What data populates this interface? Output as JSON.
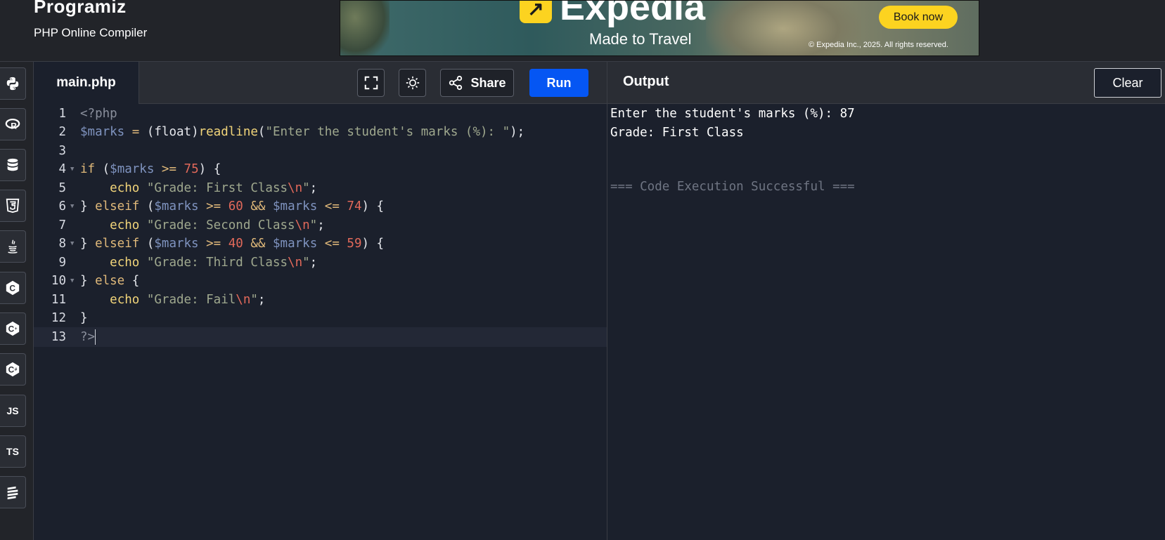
{
  "header": {
    "brand": "Programiz",
    "subtitle": "PHP Online Compiler"
  },
  "ad": {
    "brand": "Expedia",
    "tagline": "Made to Travel",
    "cta": "Book now",
    "copyright": "© Expedia Inc., 2025. All rights reserved.",
    "accent": "#fcd320"
  },
  "rail": {
    "items": [
      {
        "name": "python",
        "label": ""
      },
      {
        "name": "r",
        "label": "R"
      },
      {
        "name": "sql",
        "label": ""
      },
      {
        "name": "html",
        "label": "5"
      },
      {
        "name": "java",
        "label": ""
      },
      {
        "name": "c",
        "label": "C"
      },
      {
        "name": "cpp",
        "label": "C"
      },
      {
        "name": "csharp",
        "label": "C"
      },
      {
        "name": "javascript",
        "label": "JS"
      },
      {
        "name": "typescript",
        "label": "TS"
      },
      {
        "name": "swift",
        "label": ""
      }
    ]
  },
  "editor": {
    "file_tab": "main.php",
    "share_label": "Share",
    "run_label": "Run",
    "run_color": "#0556f3",
    "line_numbers": [
      "1",
      "2",
      "3",
      "4",
      "5",
      "6",
      "7",
      "8",
      "9",
      "10",
      "11",
      "12",
      "13"
    ],
    "lines": [
      "<?php",
      "$marks = (float)readline(\"Enter the student's marks (%): \");",
      "",
      "if ($marks >= 75) {",
      "    echo \"Grade: First Class\\n\";",
      "} elseif ($marks >= 60 && $marks <= 74) {",
      "    echo \"Grade: Second Class\\n\";",
      "} elseif ($marks >= 40 && $marks <= 59) {",
      "    echo \"Grade: Third Class\\n\";",
      "} else {",
      "    echo \"Grade: Fail\\n\";",
      "}",
      "?>"
    ]
  },
  "output": {
    "title": "Output",
    "clear_label": "Clear",
    "lines": [
      "Enter the student's marks (%): 87",
      "Grade: First Class"
    ],
    "status": "=== Code Execution Successful ==="
  }
}
